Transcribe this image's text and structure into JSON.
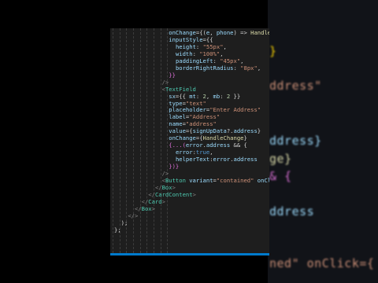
{
  "editor": {
    "lines": [
      {
        "indent": 16,
        "tokens": [
          {
            "t": "onChange",
            "c": "attr"
          },
          {
            "t": "={(",
            "c": "punc"
          },
          {
            "t": "e",
            "c": "attr"
          },
          {
            "t": ", ",
            "c": "punc"
          },
          {
            "t": "phone",
            "c": "attr"
          },
          {
            "t": ") => ",
            "c": "punc"
          },
          {
            "t": "HandleChange",
            "c": "fn"
          }
        ]
      },
      {
        "indent": 16,
        "tokens": [
          {
            "t": "inputStyle",
            "c": "attr"
          },
          {
            "t": "={{",
            "c": "punc"
          }
        ]
      },
      {
        "indent": 18,
        "tokens": [
          {
            "t": "height",
            "c": "attr"
          },
          {
            "t": ": ",
            "c": "punc"
          },
          {
            "t": "\"55px\"",
            "c": "str"
          },
          {
            "t": ",",
            "c": "punc"
          }
        ]
      },
      {
        "indent": 18,
        "tokens": [
          {
            "t": "width",
            "c": "attr"
          },
          {
            "t": ": ",
            "c": "punc"
          },
          {
            "t": "\"100%\"",
            "c": "str"
          },
          {
            "t": ",",
            "c": "punc"
          }
        ]
      },
      {
        "indent": 18,
        "tokens": [
          {
            "t": "paddingLeft",
            "c": "attr"
          },
          {
            "t": ": ",
            "c": "punc"
          },
          {
            "t": "\"45px\"",
            "c": "str"
          },
          {
            "t": ",",
            "c": "punc"
          }
        ]
      },
      {
        "indent": 18,
        "tokens": [
          {
            "t": "borderRightRadius",
            "c": "attr"
          },
          {
            "t": ": ",
            "c": "punc"
          },
          {
            "t": "\"8px\"",
            "c": "str"
          },
          {
            "t": ",",
            "c": "punc"
          }
        ]
      },
      {
        "indent": 16,
        "tokens": [
          {
            "t": "}}",
            "c": "pink"
          }
        ]
      },
      {
        "indent": 14,
        "tokens": [
          {
            "t": "/>",
            "c": "brack"
          }
        ]
      },
      {
        "indent": 14,
        "tokens": [
          {
            "t": "<",
            "c": "brack"
          },
          {
            "t": "TextField",
            "c": "tag"
          }
        ]
      },
      {
        "indent": 16,
        "tokens": [
          {
            "t": "sx",
            "c": "attr"
          },
          {
            "t": "={{ ",
            "c": "punc"
          },
          {
            "t": "mt",
            "c": "attr"
          },
          {
            "t": ": ",
            "c": "punc"
          },
          {
            "t": "2",
            "c": "num"
          },
          {
            "t": ", ",
            "c": "punc"
          },
          {
            "t": "mb",
            "c": "attr"
          },
          {
            "t": ": ",
            "c": "punc"
          },
          {
            "t": "2",
            "c": "num"
          },
          {
            "t": " }}",
            "c": "punc"
          }
        ]
      },
      {
        "indent": 16,
        "tokens": [
          {
            "t": "type",
            "c": "attr"
          },
          {
            "t": "=",
            "c": "punc"
          },
          {
            "t": "\"text\"",
            "c": "str"
          }
        ]
      },
      {
        "indent": 16,
        "tokens": [
          {
            "t": "placeholder",
            "c": "attr"
          },
          {
            "t": "=",
            "c": "punc"
          },
          {
            "t": "\"Enter Address\"",
            "c": "str"
          }
        ]
      },
      {
        "indent": 16,
        "tokens": [
          {
            "t": "label",
            "c": "attr"
          },
          {
            "t": "=",
            "c": "punc"
          },
          {
            "t": "\"Address\"",
            "c": "str"
          }
        ]
      },
      {
        "indent": 16,
        "tokens": [
          {
            "t": "name",
            "c": "attr"
          },
          {
            "t": "=",
            "c": "punc"
          },
          {
            "t": "\"address\"",
            "c": "str"
          }
        ]
      },
      {
        "indent": 16,
        "tokens": [
          {
            "t": "value",
            "c": "attr"
          },
          {
            "t": "={",
            "c": "punc"
          },
          {
            "t": "signUpData",
            "c": "attr"
          },
          {
            "t": "?.",
            "c": "punc"
          },
          {
            "t": "address",
            "c": "attr"
          },
          {
            "t": "}",
            "c": "punc"
          }
        ]
      },
      {
        "indent": 16,
        "tokens": [
          {
            "t": "onChange",
            "c": "attr"
          },
          {
            "t": "={",
            "c": "punc"
          },
          {
            "t": "HandleChange",
            "c": "fn"
          },
          {
            "t": "}",
            "c": "punc"
          }
        ]
      },
      {
        "indent": 16,
        "tokens": [
          {
            "t": "{...(",
            "c": "pink"
          },
          {
            "t": "error",
            "c": "attr"
          },
          {
            "t": ".",
            "c": "punc"
          },
          {
            "t": "address",
            "c": "attr"
          },
          {
            "t": " && {",
            "c": "punc"
          }
        ]
      },
      {
        "indent": 18,
        "tokens": [
          {
            "t": "error",
            "c": "attr"
          },
          {
            "t": ":",
            "c": "punc"
          },
          {
            "t": "true",
            "c": "kw"
          },
          {
            "t": ",",
            "c": "punc"
          }
        ]
      },
      {
        "indent": 18,
        "tokens": [
          {
            "t": "helperText",
            "c": "attr"
          },
          {
            "t": ":",
            "c": "punc"
          },
          {
            "t": "error",
            "c": "attr"
          },
          {
            "t": ".",
            "c": "punc"
          },
          {
            "t": "address",
            "c": "attr"
          }
        ]
      },
      {
        "indent": 16,
        "tokens": [
          {
            "t": "})}",
            "c": "pink"
          }
        ]
      },
      {
        "indent": 14,
        "tokens": [
          {
            "t": "/>",
            "c": "brack"
          }
        ]
      },
      {
        "indent": 14,
        "tokens": [
          {
            "t": "<",
            "c": "brack"
          },
          {
            "t": "Button",
            "c": "tag"
          },
          {
            "t": " ",
            "c": "punc"
          },
          {
            "t": "variant",
            "c": "attr"
          },
          {
            "t": "=",
            "c": "punc"
          },
          {
            "t": "\"contained\"",
            "c": "str"
          },
          {
            "t": " ",
            "c": "punc"
          },
          {
            "t": "onClick",
            "c": "attr"
          },
          {
            "t": "={",
            "c": "punc"
          }
        ]
      },
      {
        "indent": 12,
        "tokens": [
          {
            "t": "</",
            "c": "brack"
          },
          {
            "t": "Box",
            "c": "tag"
          },
          {
            "t": ">",
            "c": "brack"
          }
        ]
      },
      {
        "indent": 10,
        "tokens": [
          {
            "t": "</",
            "c": "brack"
          },
          {
            "t": "CardContent",
            "c": "tag"
          },
          {
            "t": ">",
            "c": "brack"
          }
        ]
      },
      {
        "indent": 8,
        "tokens": [
          {
            "t": "</",
            "c": "brack"
          },
          {
            "t": "Card",
            "c": "tag"
          },
          {
            "t": ">",
            "c": "brack"
          }
        ]
      },
      {
        "indent": 6,
        "tokens": [
          {
            "t": "</",
            "c": "brack"
          },
          {
            "t": "Box",
            "c": "tag"
          },
          {
            "t": ">",
            "c": "brack"
          }
        ]
      },
      {
        "indent": 4,
        "tokens": [
          {
            "t": "</>",
            "c": "brack"
          }
        ]
      },
      {
        "indent": 2,
        "tokens": [
          {
            "t": ");",
            "c": "punc"
          }
        ]
      },
      {
        "indent": 0,
        "tokens": [
          {
            "t": "};",
            "c": "punc"
          }
        ]
      }
    ]
  },
  "background": {
    "lines": [
      {
        "text": "}",
        "color": "#ffd700"
      },
      {
        "text": "ddress\"",
        "color": "#ce9178"
      },
      {
        "text": "ddress}",
        "color": "#9cdcfe"
      },
      {
        "text": "ge}",
        "color": "#dcdcaa"
      },
      {
        "text": "& {",
        "color": "#da70d6"
      },
      {
        "text": "ddress",
        "color": "#9cdcfe"
      },
      {
        "text": "ned\" onClick={",
        "color": "#ce9178"
      }
    ]
  }
}
